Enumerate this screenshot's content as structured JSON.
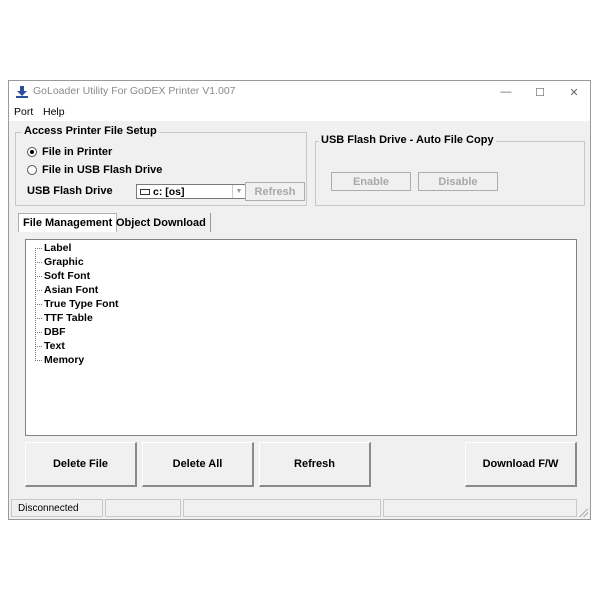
{
  "window": {
    "title": "GoLoader Utility For GoDEX Printer  V1.007",
    "controls": {
      "minimize": "—",
      "maximize": "☐",
      "close": "✕"
    },
    "icon": "download-arrow-icon"
  },
  "menu": {
    "items": [
      "Port",
      "Help"
    ]
  },
  "access_setup": {
    "title": "Access Printer File Setup",
    "radios": [
      {
        "label": "File in Printer",
        "checked": true
      },
      {
        "label": "File in USB Flash Drive",
        "checked": false
      }
    ],
    "usb_label": "USB Flash Drive",
    "drive_value": "c: [os]",
    "refresh_label": "Refresh"
  },
  "auto_copy": {
    "title": "USB Flash Drive - Auto File Copy",
    "enable_label": "Enable",
    "disable_label": "Disable"
  },
  "tabs": [
    {
      "label": "File Management",
      "active": true
    },
    {
      "label": "Object Download",
      "active": false
    }
  ],
  "tree": {
    "items": [
      "Label",
      "Graphic",
      "Soft Font",
      "Asian Font",
      "True Type Font",
      "TTF Table",
      "DBF",
      "Text",
      "Memory"
    ]
  },
  "actions": {
    "delete_file": "Delete File",
    "delete_all": "Delete All",
    "refresh": "Refresh",
    "download_fw": "Download F/W"
  },
  "status": {
    "connection": "Disconnected"
  },
  "colors": {
    "window_bg": "#f0f0f0",
    "icon_blue": "#2a4fa0",
    "disabled_text": "#a8a8a8"
  }
}
